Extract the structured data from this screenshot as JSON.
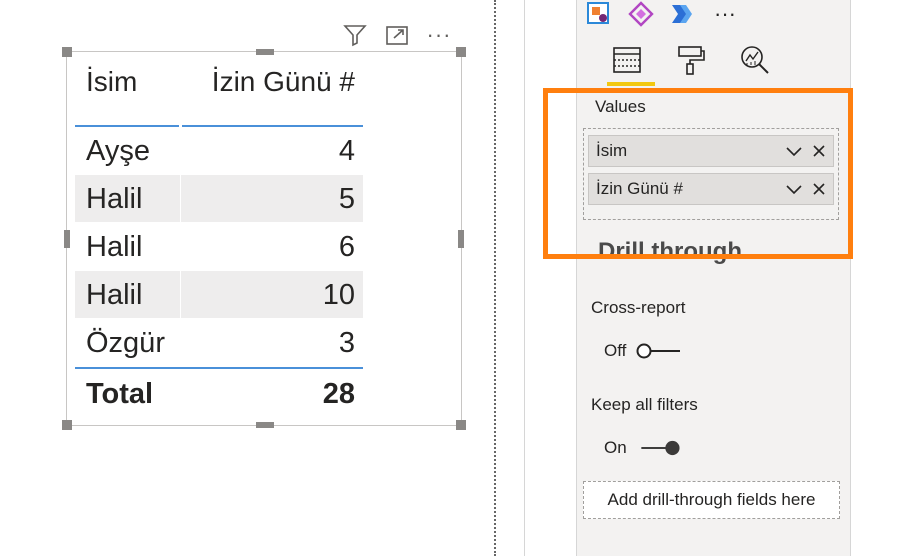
{
  "table": {
    "headers": {
      "name": "İsim",
      "days": "İzin Günü #"
    },
    "rows": [
      {
        "name": "Ayşe",
        "days": "4"
      },
      {
        "name": "Halil",
        "days": "5"
      },
      {
        "name": "Halil",
        "days": "6"
      },
      {
        "name": "Halil",
        "days": "10"
      },
      {
        "name": "Özgür",
        "days": "3"
      }
    ],
    "total": {
      "label": "Total",
      "value": "28"
    }
  },
  "visual_header": {
    "icons": [
      "filter-icon",
      "focus-mode-icon",
      "more-options-icon"
    ],
    "more_label": "···"
  },
  "pane": {
    "viz_icons": [
      "powerapps-icon",
      "power-automate-icon",
      "more-visuals-icon"
    ],
    "more_label": "···",
    "tabs": [
      "fields-tab",
      "format-tab",
      "analytics-tab"
    ],
    "values_label": "Values",
    "fields": [
      {
        "label": "İsim"
      },
      {
        "label": "İzin Günü #"
      }
    ],
    "drill_through": {
      "heading": "Drill through",
      "cross_report_label": "Cross-report",
      "cross_report_state": "Off",
      "keep_filters_label": "Keep all filters",
      "keep_filters_state": "On",
      "drop_zone_label": "Add drill-through fields here"
    }
  },
  "colors": {
    "highlight": "#ff7f0e",
    "accent_line": "#4a90d9",
    "active_tab": "#f2c811"
  }
}
